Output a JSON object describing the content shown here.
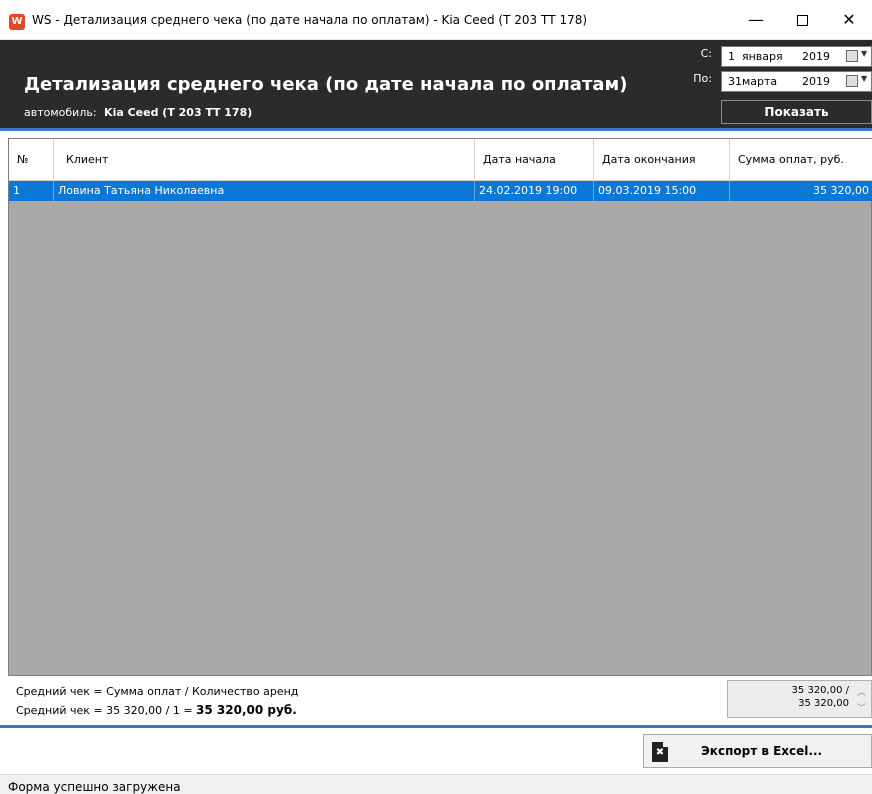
{
  "window": {
    "app_icon_letter": "W",
    "title": "WS - Детализация среднего чека (по дате начала по оплатам) - Kia Ceed (Т 203 ТТ 178)",
    "min_symbol": "—",
    "close_symbol": "✕"
  },
  "header": {
    "title": "Детализация среднего чека (по дате начала по оплатам)",
    "vehicle_label": "автомобиль:",
    "vehicle_value": "Kia Ceed (Т 203 ТТ 178)",
    "date_from_label": "С:",
    "date_from": {
      "day": "1",
      "month": "января",
      "year": "2019"
    },
    "date_to_label": "По:",
    "date_to": {
      "day": "31",
      "month": "марта",
      "year": "2019"
    },
    "show_button": "Показать"
  },
  "table": {
    "columns": [
      "№",
      "Клиент",
      "Дата начала",
      "Дата окончания",
      "Сумма оплат, руб."
    ],
    "rows": [
      {
        "num": "1",
        "client": "Ловина Татьяна Николаевна",
        "start": "24.02.2019 19:00",
        "end": "09.03.2019 15:00",
        "sum": "35 320,00"
      }
    ]
  },
  "summary": {
    "formula_line1": "Средний чек = Сумма оплат / Количество аренд",
    "formula_line2_prefix": "Средний чек = 35 320,00 / 1 = ",
    "formula_line2_result": "35 320,00 руб.",
    "box_line1": "35 320,00 /",
    "box_line2": "35 320,00"
  },
  "footer": {
    "export_button": "Экспорт в Excel...",
    "status": "Форма успешно загружена"
  },
  "colors": {
    "header_bg": "#2b2b2b",
    "accent": "#3a78c4",
    "selection": "#0c78d6",
    "grid_bg": "#a9a9a9"
  }
}
